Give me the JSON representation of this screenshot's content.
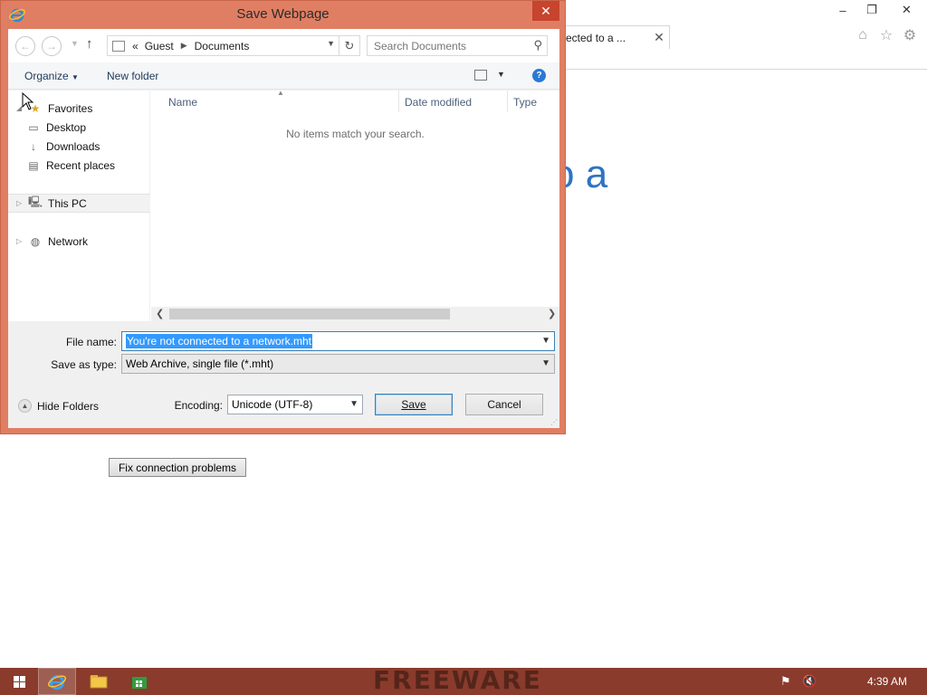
{
  "browser": {
    "tab_title": "ected to a ...",
    "heading_fragment": "o a",
    "fix_button_label": "Fix connection problems",
    "window_controls": {
      "minimize": "–",
      "restore": "❐",
      "close": "✕"
    },
    "toolbar_icons": [
      "home-icon",
      "star-icon",
      "gear-icon"
    ]
  },
  "dialog": {
    "title": "Save Webpage",
    "close_glyph": "✕",
    "address": {
      "overflow": "«",
      "crumbs": [
        "Guest",
        "Documents"
      ]
    },
    "search_placeholder": "Search Documents",
    "commands": {
      "organize": "Organize",
      "new_folder": "New folder",
      "help": "?"
    },
    "nav_pane": {
      "favorites": "Favorites",
      "desktop": "Desktop",
      "downloads": "Downloads",
      "recent_places": "Recent places",
      "this_pc": "This PC",
      "network": "Network"
    },
    "columns": {
      "name": "Name",
      "date_modified": "Date modified",
      "type": "Type"
    },
    "empty_message": "No items match your search.",
    "form": {
      "file_name_label": "File name:",
      "file_name_value": "You're not connected to a network.mht",
      "save_as_type_label": "Save as type:",
      "save_as_type_value": "Web Archive, single file (*.mht)",
      "encoding_label": "Encoding:",
      "encoding_value": "Unicode (UTF-8)",
      "hide_folders": "Hide Folders",
      "save": "Save",
      "cancel": "Cancel"
    }
  },
  "taskbar": {
    "watermark": "FREEWARE",
    "time": "4:39 AM",
    "apps": [
      "internet-explorer",
      "file-explorer",
      "store"
    ]
  },
  "colors": {
    "dialog_frame": "#e07e63",
    "taskbar": "#8a3b2c",
    "selection": "#3399ff",
    "link_blue": "#2d74c4"
  }
}
